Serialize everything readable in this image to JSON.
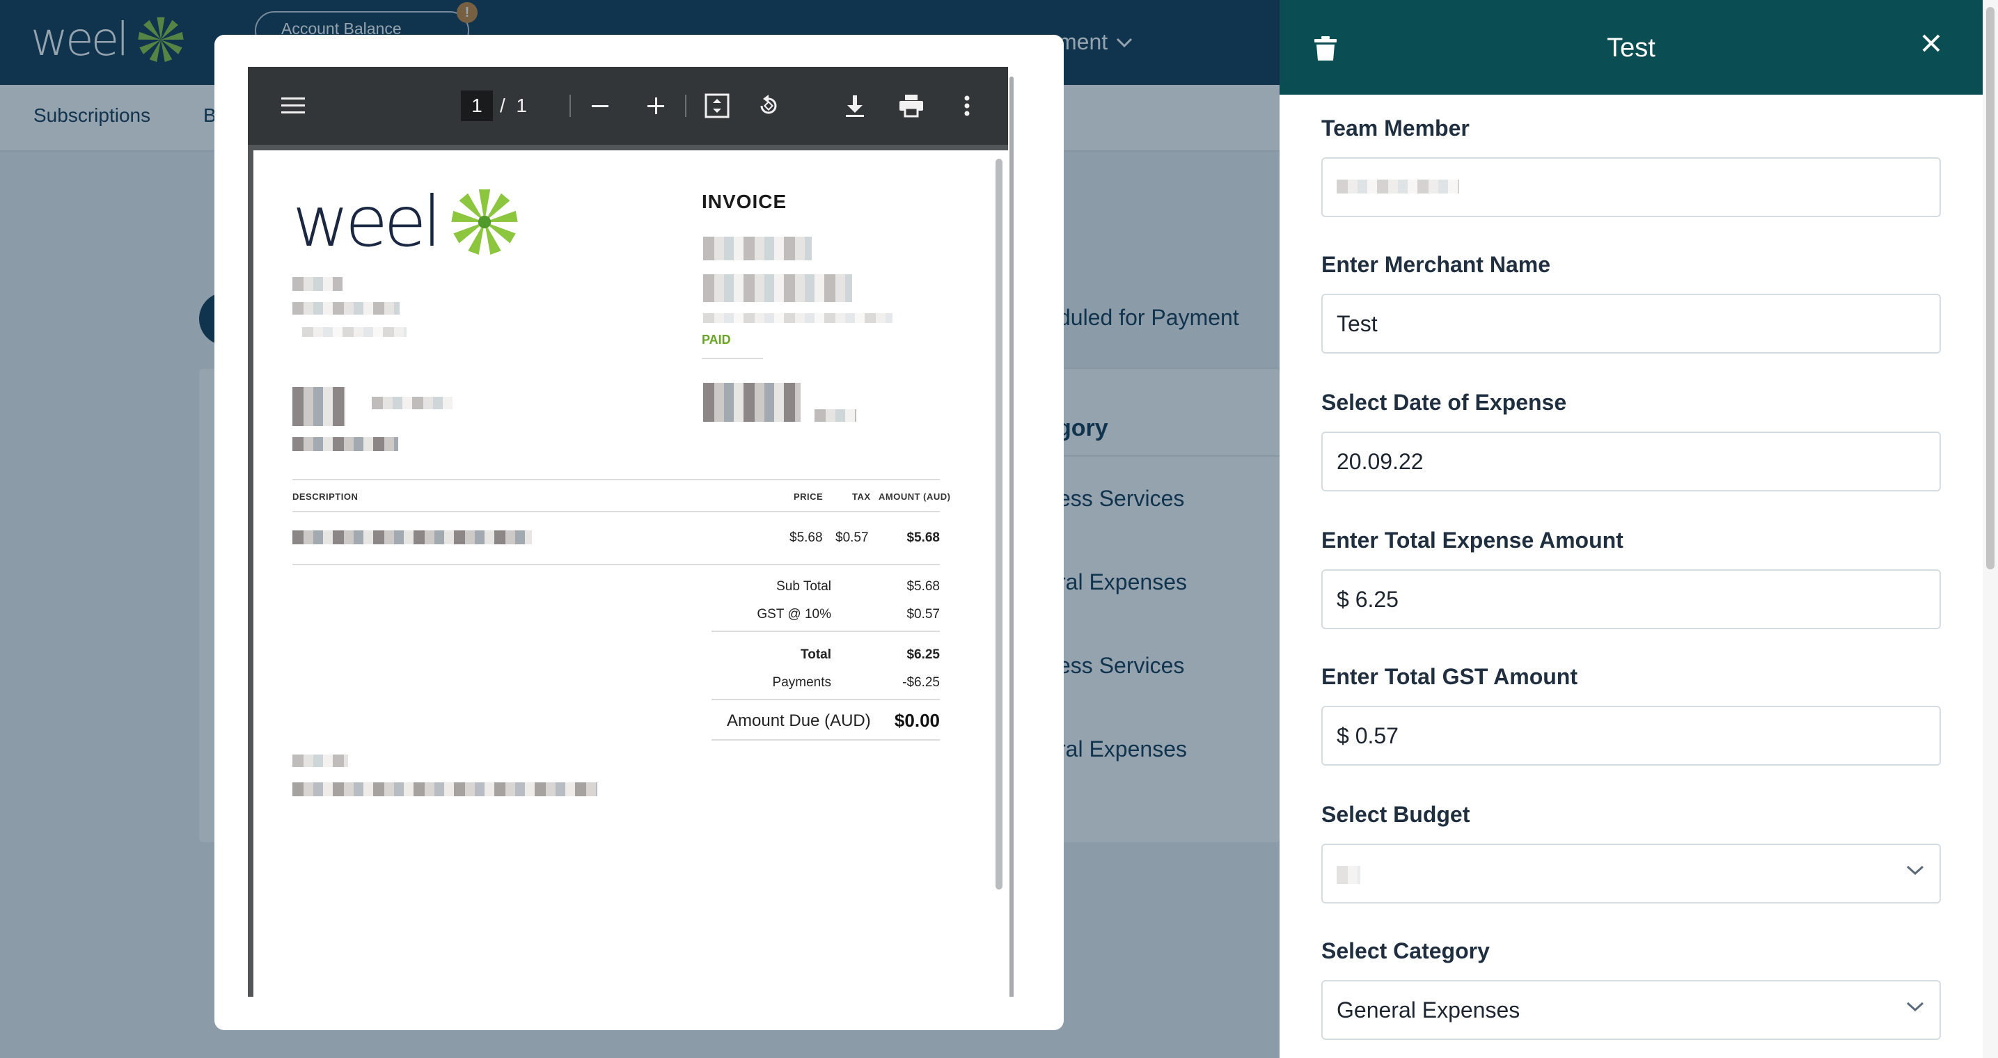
{
  "app": {
    "logo_text": "weel",
    "account_balance_label": "Account Balance",
    "alert_badge": "!",
    "header_menu_label": "ment",
    "subnav": [
      "Subscriptions",
      "B"
    ],
    "bg_texts": {
      "scheduled": "duled for Payment",
      "category_header": "gory",
      "row1": "ess Services",
      "row2": "ral Expenses",
      "row3": "ess Services",
      "row4": "ral Expenses"
    }
  },
  "pdf_viewer": {
    "page_current": "1",
    "page_total": "1",
    "toolbar_icons": [
      "menu-icon",
      "zoom-out-icon",
      "zoom-in-icon",
      "fit-page-icon",
      "rotate-icon",
      "download-icon",
      "print-icon",
      "more-vert-icon"
    ],
    "invoice": {
      "logo_text": "weel",
      "title": "INVOICE",
      "status": "PAID",
      "headers": {
        "description": "DESCRIPTION",
        "price": "PRICE",
        "tax": "TAX",
        "amount": "AMOUNT (AUD)"
      },
      "line_item": {
        "price": "$5.68",
        "tax": "$0.57",
        "amount": "$5.68"
      },
      "summary": [
        {
          "label": "Sub Total",
          "value": "$5.68"
        },
        {
          "label": "GST @ 10%",
          "value": "$0.57"
        },
        {
          "label": "Total",
          "value": "$6.25"
        },
        {
          "label": "Payments",
          "value": "-$6.25"
        }
      ],
      "amount_due_label": "Amount Due (AUD)",
      "amount_due_value": "$0.00"
    }
  },
  "panel": {
    "title": "Test",
    "fields": {
      "team_member": {
        "label": "Team Member",
        "value": ""
      },
      "merchant": {
        "label": "Enter Merchant Name",
        "value": "Test"
      },
      "date": {
        "label": "Select Date of Expense",
        "value": "20.09.22"
      },
      "total": {
        "label": "Enter Total Expense Amount",
        "value": "$ 6.25"
      },
      "gst": {
        "label": "Enter Total GST Amount",
        "value": "$ 0.57"
      },
      "budget": {
        "label": "Select Budget",
        "value": ""
      },
      "category": {
        "label": "Select Category",
        "value": "General Expenses"
      }
    }
  },
  "colors": {
    "header_navy": "#0d3350",
    "panel_teal": "#0a4e53",
    "brand_green": "#8cc63f",
    "paid_green": "#6aa52a"
  }
}
